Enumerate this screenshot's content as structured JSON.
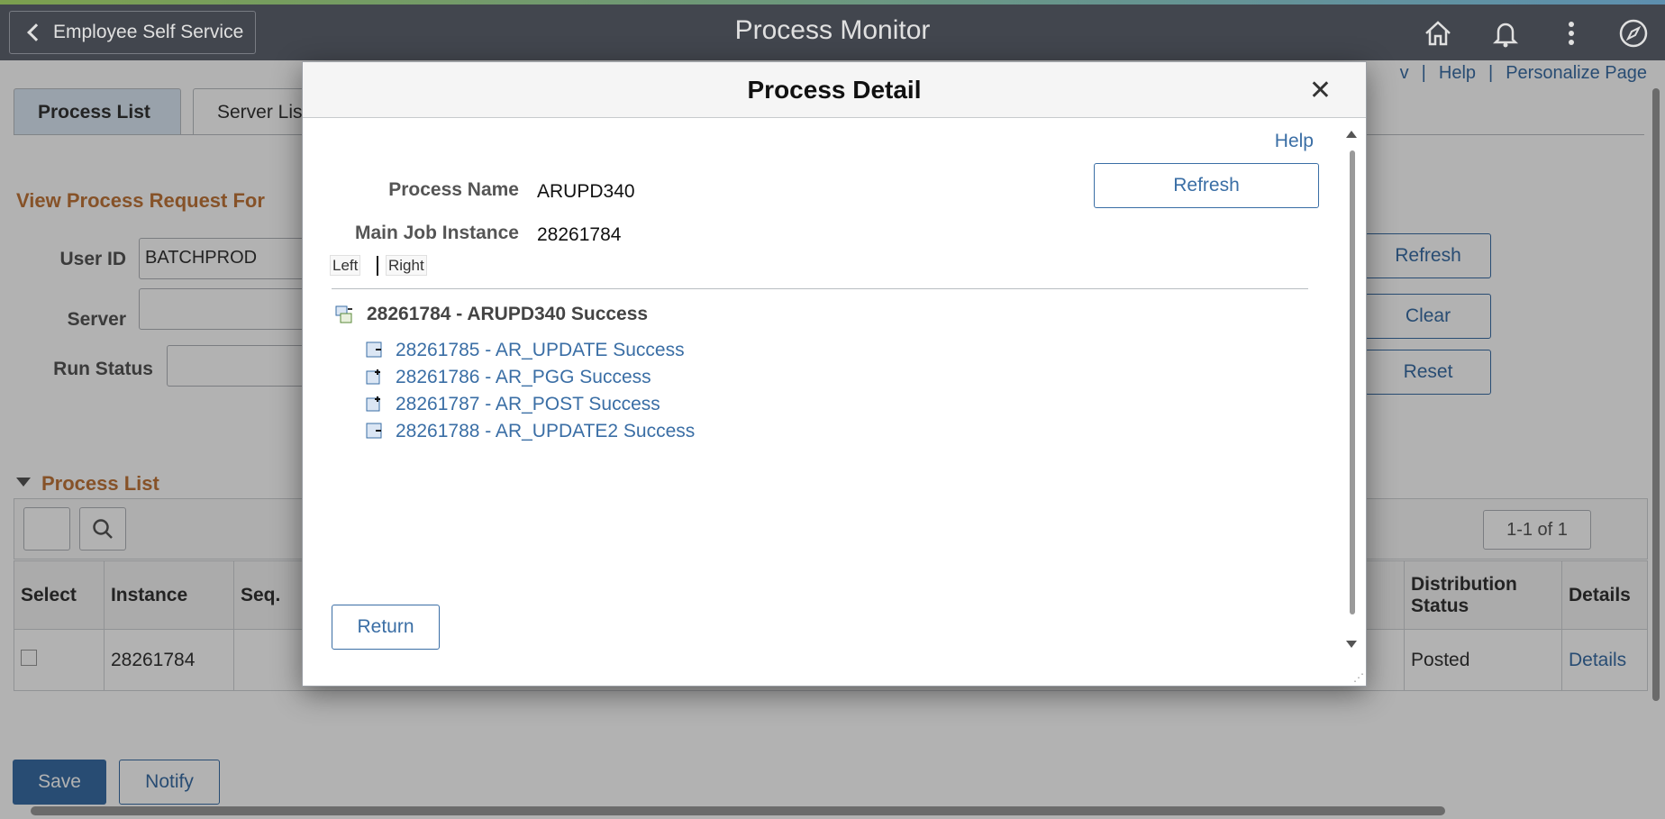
{
  "header": {
    "back_label": "Employee Self Service",
    "title": "Process Monitor",
    "icons": [
      "home-icon",
      "bell-icon",
      "more-vertical-icon",
      "compass-icon"
    ]
  },
  "toplinks": {
    "fragment": "v",
    "help": "Help",
    "personalize": "Personalize Page"
  },
  "tabs": [
    {
      "label": "Process List",
      "active": true
    },
    {
      "label": "Server List",
      "active": false
    }
  ],
  "criteria": {
    "title": "View Process Request For",
    "user_id_label": "User ID",
    "user_id_value": "BATCHPROD",
    "server_label": "Server",
    "run_status_label": "Run Status",
    "refresh": "Refresh",
    "clear": "Clear",
    "reset": "Reset"
  },
  "process_list": {
    "title": "Process List",
    "pager": "1-1 of 1",
    "columns": [
      "Select",
      "Instance",
      "Seq.",
      "Distribution Status",
      "Details"
    ],
    "rows": [
      {
        "instance": "28261784",
        "distribution_status": "Posted",
        "details": "Details"
      }
    ]
  },
  "footer": {
    "save": "Save",
    "notify": "Notify"
  },
  "modal": {
    "title": "Process Detail",
    "help": "Help",
    "refresh": "Refresh",
    "process_name_label": "Process Name",
    "process_name_value": "ARUPD340",
    "main_job_label": "Main Job Instance",
    "main_job_value": "28261784",
    "left": "Left",
    "right": "Right",
    "tree_root": "28261784 - ARUPD340 Success",
    "tree_items": [
      "28261785 - AR_UPDATE Success",
      "28261786 - AR_PGG Success",
      "28261787 - AR_POST Success",
      "28261788 - AR_UPDATE2 Success"
    ],
    "return": "Return"
  },
  "colors": {
    "header_bg": "#4c5059",
    "link": "#3a6ea5",
    "section_title": "#c0763a",
    "tab_active_bg": "#dbe8f5"
  }
}
